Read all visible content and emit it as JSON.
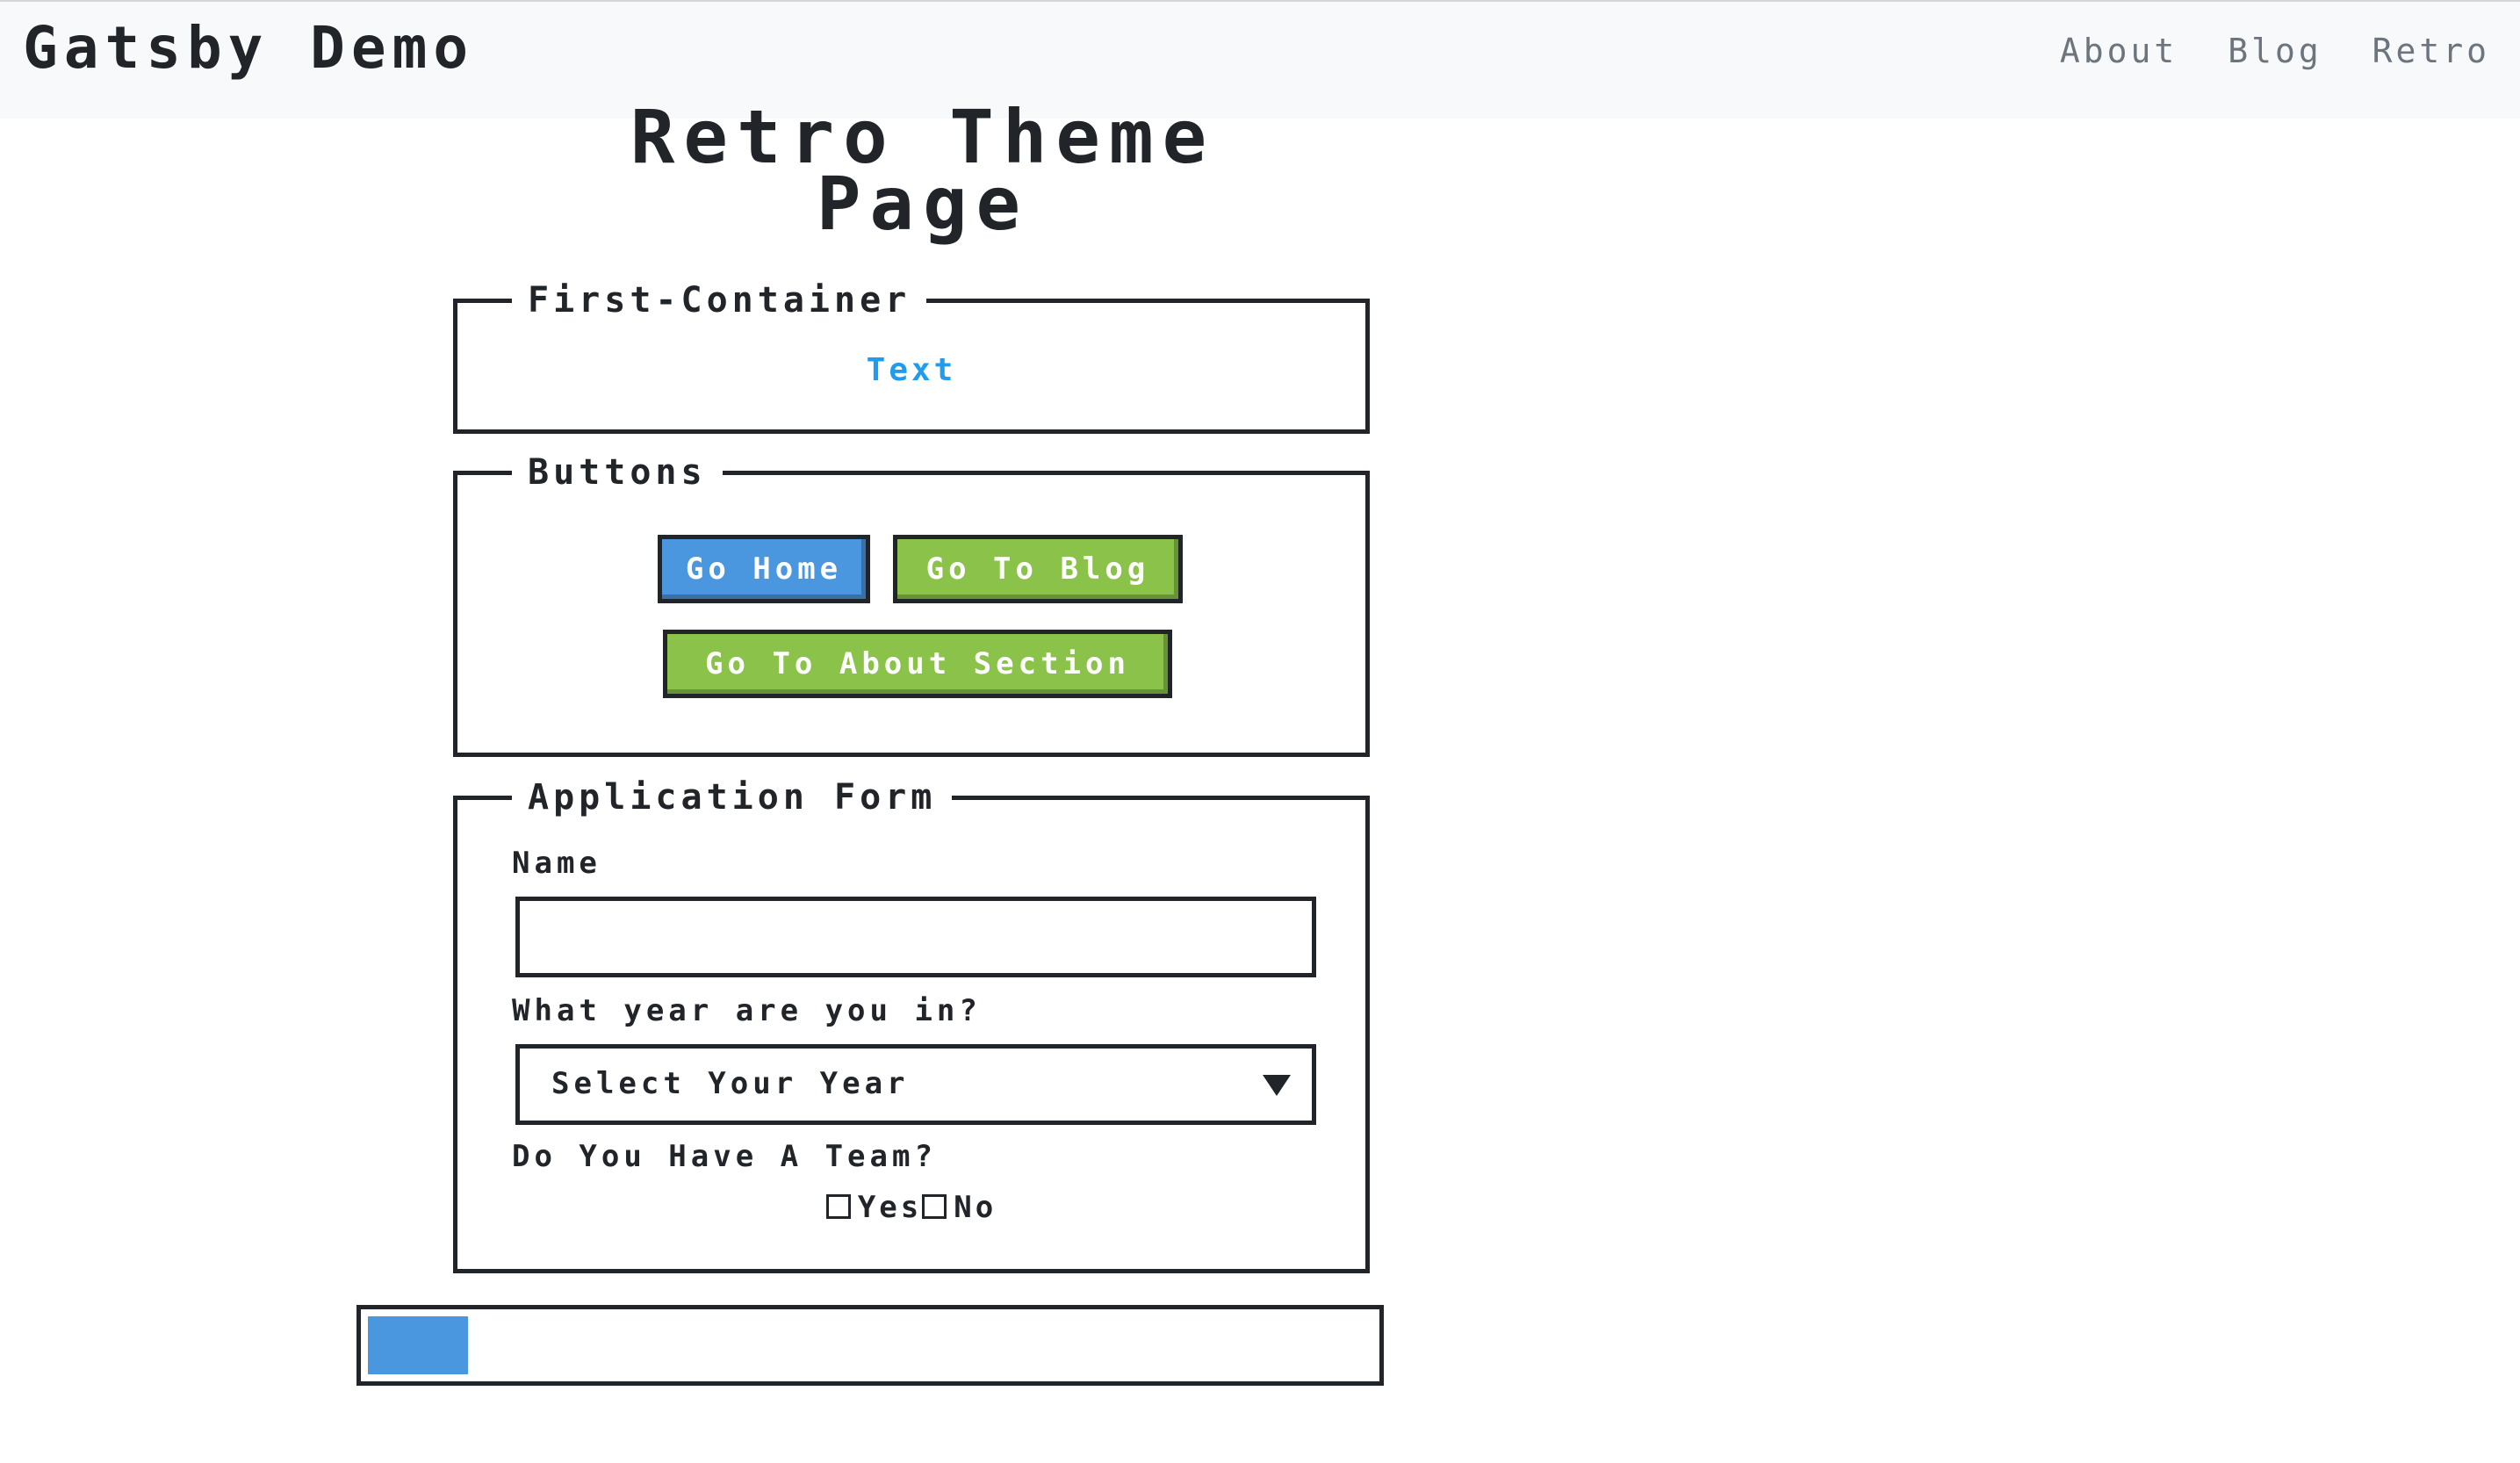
{
  "navbar": {
    "brand": "Gatsby Demo",
    "links": [
      "About",
      "Blog",
      "Retro"
    ]
  },
  "page": {
    "title": "Retro Theme Page"
  },
  "first_container": {
    "title": "First-Container",
    "text_link": "Text"
  },
  "buttons_panel": {
    "title": "Buttons",
    "go_home": "Go Home",
    "go_blog": "Go To Blog",
    "go_about": "Go To About Section"
  },
  "form": {
    "title": "Application Form",
    "name_label": "Name",
    "name_value": "",
    "year_label": "What year are you in?",
    "year_selected": "Select Your Year",
    "team_label": "Do You Have A Team?",
    "team_options": [
      "Yes",
      "No"
    ]
  },
  "progress": {
    "value": 0.1,
    "color": "#4a97e0"
  },
  "colors": {
    "primary": "#4a97e0",
    "success": "#8bc34a",
    "link": "#209cee"
  }
}
